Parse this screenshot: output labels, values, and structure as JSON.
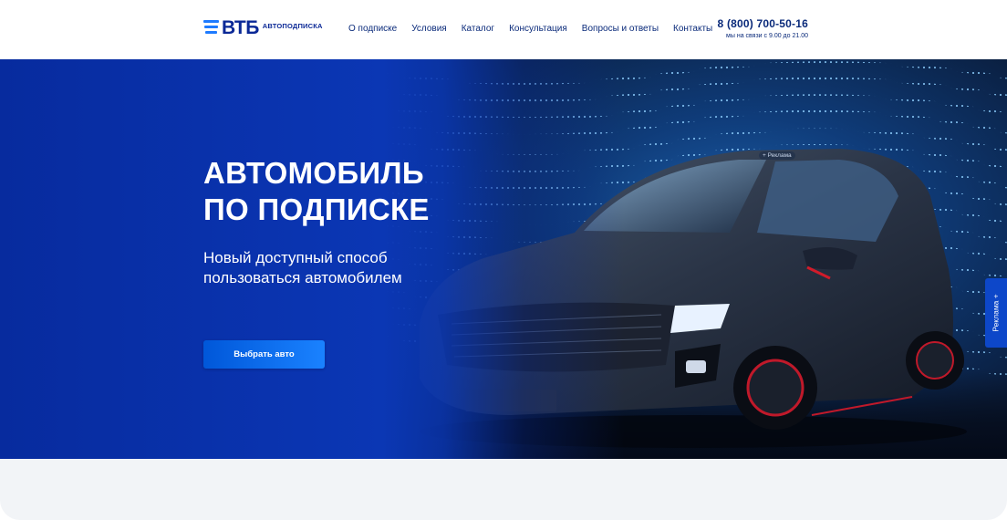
{
  "header": {
    "logo_text": "ВТБ",
    "logo_sub": "АВТОПОДПИСКА",
    "nav": [
      {
        "label": "О подписке"
      },
      {
        "label": "Условия"
      },
      {
        "label": "Каталог"
      },
      {
        "label": "Консультация"
      },
      {
        "label": "Вопросы и ответы"
      },
      {
        "label": "Контакты"
      }
    ],
    "phone": "8 (800) 700-50-16",
    "hours": "мы на связи с 9.00 до 21.00"
  },
  "hero": {
    "title": "АВТОМОБИЛЬ\nПО ПОДПИСКЕ",
    "subtitle": "Новый доступный способ\nпользоваться автомобилем",
    "cta_label": "Выбрать авто",
    "ad_mark": "+ Реклама",
    "ad_tab": "Реклама +"
  },
  "colors": {
    "brand_blue": "#0a2896",
    "hero_blue": "#0a34b0",
    "button_blue": "#1a82ff",
    "bottom_bg": "#f2f4f7"
  },
  "icons": {
    "logo": "vtb-stripes-icon"
  }
}
